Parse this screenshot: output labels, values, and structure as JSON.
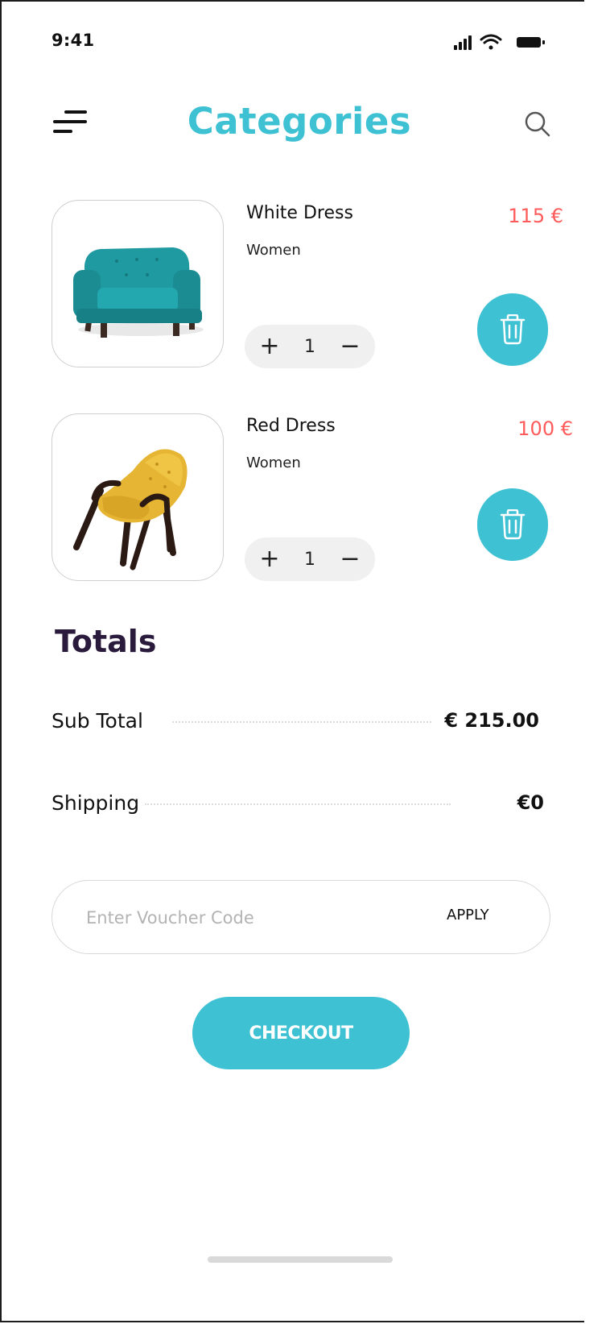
{
  "status_bar": {
    "time": "9:41"
  },
  "header": {
    "title": "Categories",
    "menu_icon": "menu-icon",
    "search_icon": "search-icon"
  },
  "cart": {
    "items": [
      {
        "name": "White Dress",
        "category": "Women",
        "price": "115 €",
        "quantity": "1",
        "plus": "+",
        "minus": "−",
        "image": "teal-armchair"
      },
      {
        "name": "Red Dress",
        "category": "Women",
        "price": "100 €",
        "quantity": "1",
        "plus": "+",
        "minus": "−",
        "image": "yellow-armchair"
      }
    ]
  },
  "totals": {
    "title": "Totals",
    "subtotal_label": "Sub Total",
    "subtotal_value": "€ 215.00",
    "shipping_label": "Shipping",
    "shipping_value": "€0"
  },
  "voucher": {
    "placeholder": "Enter Voucher Code",
    "value": "",
    "apply_label": "APPLY"
  },
  "checkout": {
    "label": "CHECKOUT"
  },
  "colors": {
    "accent": "#3dc1d3",
    "price": "#ff5b5b",
    "heading": "#2a1b3d"
  }
}
